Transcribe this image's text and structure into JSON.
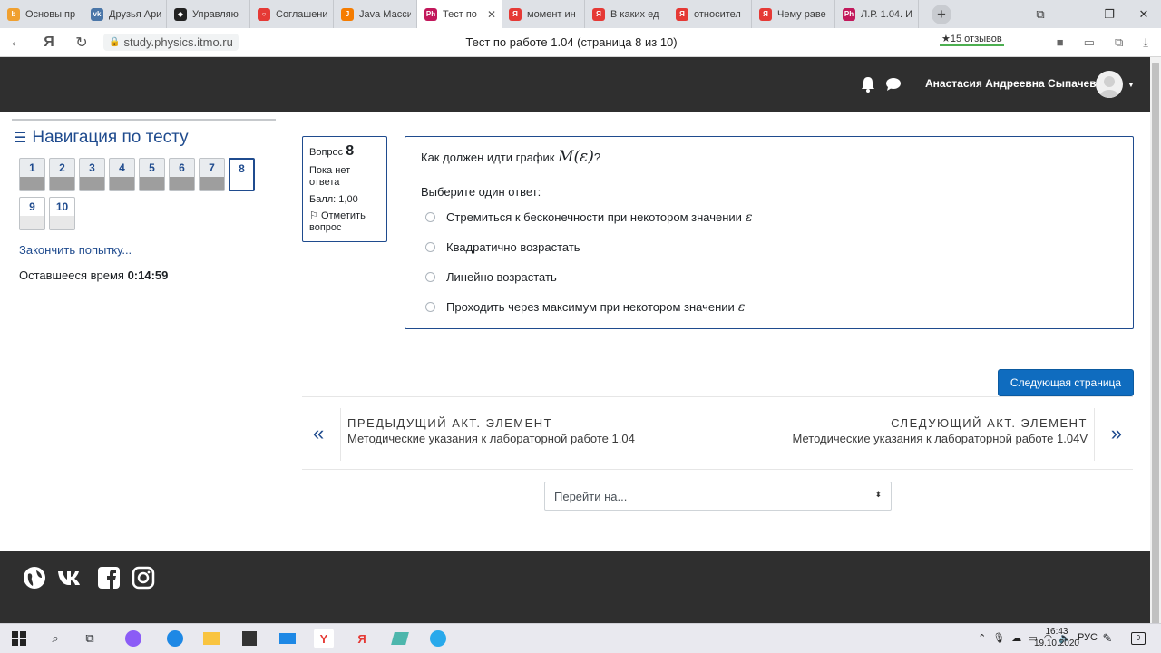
{
  "browser": {
    "tabs": [
      {
        "title": "Основы пр",
        "color": "#f0a030",
        "glyph": "b"
      },
      {
        "title": "Друзья Ари",
        "color": "#4a76a8",
        "glyph": "vk"
      },
      {
        "title": "Управляю",
        "color": "#222222",
        "glyph": "◆"
      },
      {
        "title": "Соглашени",
        "color": "#e53935",
        "glyph": "○"
      },
      {
        "title": "Java Масси",
        "color": "#f57c00",
        "glyph": "J"
      },
      {
        "title": "Тест по",
        "color": "#c2185b",
        "glyph": "Ph",
        "active": true
      },
      {
        "title": "момент ин",
        "color": "#e53935",
        "glyph": "Я"
      },
      {
        "title": "В каких ед",
        "color": "#e53935",
        "glyph": "Я"
      },
      {
        "title": "относител",
        "color": "#e53935",
        "glyph": "Я"
      },
      {
        "title": "Чему раве",
        "color": "#e53935",
        "glyph": "Я"
      },
      {
        "title": "Л.Р. 1.04. И",
        "color": "#c2185b",
        "glyph": "Ph"
      }
    ],
    "url": "study.physics.itmo.ru",
    "page_title": "Тест по работе 1.04 (страница 8 из 10)",
    "reviews": "★15 отзывов"
  },
  "header": {
    "username": "Анастасия Андреевна Сыпачева"
  },
  "nav": {
    "title": "Навигация по тесту",
    "questions": [
      {
        "label": "1",
        "state": "answered"
      },
      {
        "label": "2",
        "state": "answered"
      },
      {
        "label": "3",
        "state": "answered"
      },
      {
        "label": "4",
        "state": "answered"
      },
      {
        "label": "5",
        "state": "answered"
      },
      {
        "label": "6",
        "state": "answered"
      },
      {
        "label": "7",
        "state": "answered"
      },
      {
        "label": "8",
        "state": "current"
      },
      {
        "label": "9",
        "state": "empty"
      },
      {
        "label": "10",
        "state": "empty"
      }
    ],
    "finish_label": "Закончить попытку...",
    "timer_label": "Оставшееся время",
    "timer_value": "0:14:59"
  },
  "question": {
    "number_prefix": "Вопрос",
    "number": "8",
    "state": "Пока нет ответа",
    "grade": "Балл: 1,00",
    "flag_label": "Отметить вопрос",
    "text_prefix": "Как должен идти график",
    "formula": "M(ε)",
    "text_suffix": "?",
    "prompt": "Выберите один ответ:",
    "answers": [
      {
        "text": "Стремиться к бесконечности при некотором значении",
        "symbol": "ε"
      },
      {
        "text": "Квадратично возрастать",
        "symbol": ""
      },
      {
        "text": "Линейно возрастать",
        "symbol": ""
      },
      {
        "text": "Проходить через максимум при некотором значении",
        "symbol": "ε"
      }
    ]
  },
  "next_page_label": "Следующая страница",
  "activity_nav": {
    "prev_heading": "ПРЕДЫДУЩИЙ АКТ. ЭЛЕМЕНТ",
    "prev_link": "Методические указания к лабораторной работе 1.04",
    "next_heading": "СЛЕДУЮЩИЙ АКТ. ЭЛЕМЕНТ",
    "next_link": "Методические указания к лабораторной работе 1.04V"
  },
  "jump_to": {
    "placeholder": "Перейти на..."
  },
  "taskbar": {
    "lang": "РУС",
    "time": "16:43",
    "date": "19.10.2020",
    "notification_count": "9"
  }
}
